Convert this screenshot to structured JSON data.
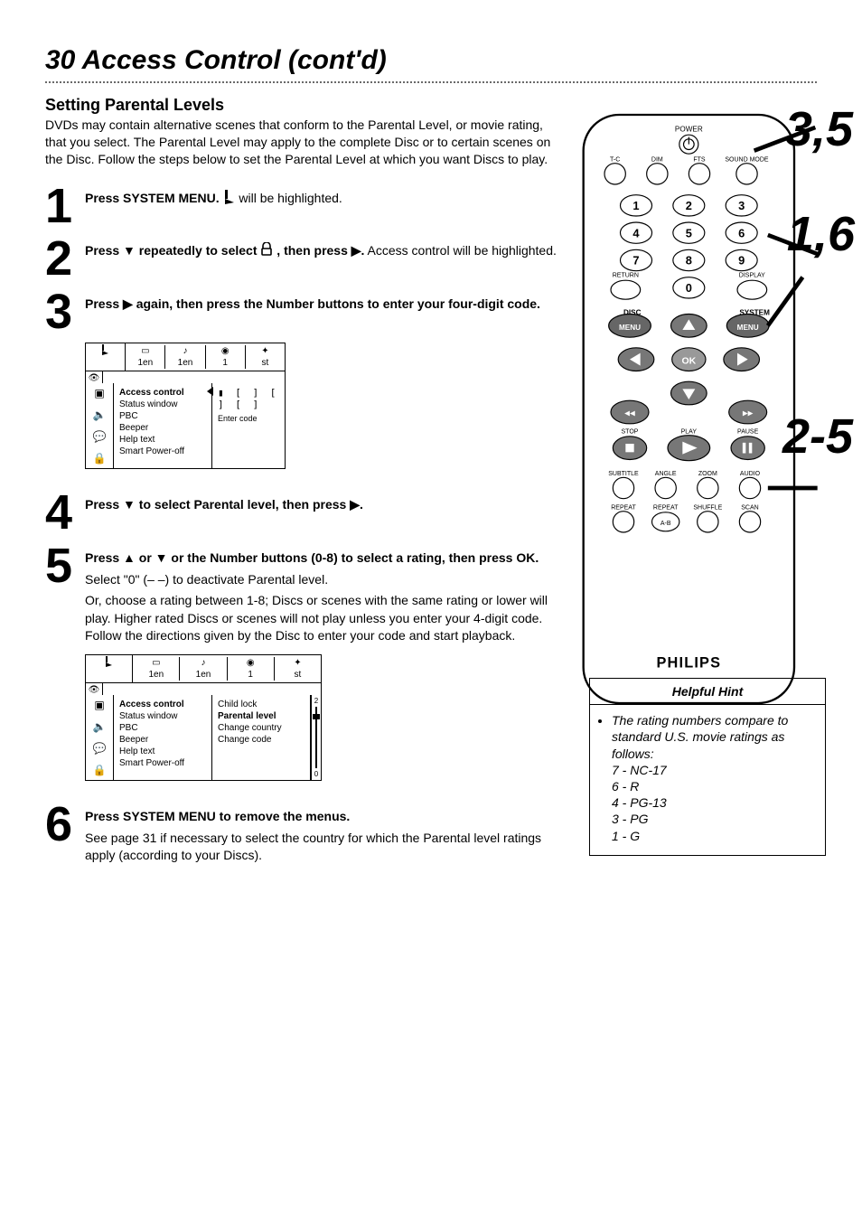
{
  "page_title": "30  Access Control (cont'd)",
  "section_heading": "Setting Parental Levels",
  "intro": "DVDs may contain alternative scenes that conform to the Parental Level, or movie rating, that you select. The Parental Level may apply to the complete Disc or to certain scenes on the Disc. Follow the steps below to set the Parental Level at which you want Discs to play.",
  "steps": {
    "s1_num": "1",
    "s1_strong": "Press SYSTEM MENU.",
    "s1_rest": " will be highlighted.",
    "s2_num": "2",
    "s2_strong_a": "Press ▼ repeatedly to select ",
    "s2_strong_b": ", then press ▶.",
    "s2_rest": " Access control will be highlighted.",
    "s3_num": "3",
    "s3_strong": "Press ▶ again, then press the Number buttons to enter your four-digit code.",
    "s4_num": "4",
    "s4_strong": "Press ▼ to select Parental level, then press ▶.",
    "s5_num": "5",
    "s5_strong": "Press ▲ or ▼ or the Number buttons (0-8) to select a rating, then press OK.",
    "s5_p1": "Select \"0\" (– –) to deactivate Parental level.",
    "s5_p2": "Or, choose a rating between 1-8; Discs or scenes with the same rating or lower will play. Higher rated Discs or scenes will not play unless you enter your 4-digit code. Follow the directions given by the Disc to enter your code and start playback.",
    "s6_num": "6",
    "s6_strong": "Press SYSTEM MENU to remove the menus.",
    "s6_rest": "See page 31 if necessary to select the country for which the Parental level ratings apply (according to your Discs)."
  },
  "osd1": {
    "top_labels": [
      "1en",
      "1en",
      "1",
      "st"
    ],
    "menu": [
      "Access control",
      "Status window",
      "PBC",
      "Beeper",
      "Help text",
      "Smart Power-off"
    ],
    "right_slots": "▮ [ ] [ ] [ ]",
    "right_text": "Enter code"
  },
  "osd2": {
    "top_labels": [
      "1en",
      "1en",
      "1",
      "st"
    ],
    "menu": [
      "Access control",
      "Status window",
      "PBC",
      "Beeper",
      "Help text",
      "Smart Power-off"
    ],
    "submenu": [
      "Child lock",
      "Parental level",
      "Change country",
      "Change code"
    ],
    "slider_top": "2",
    "slider_bottom": "0"
  },
  "remote": {
    "top_labels": [
      "POWER",
      "T-C",
      "DIM",
      "FTS",
      "SOUND MODE"
    ],
    "numpad": [
      "1",
      "2",
      "3",
      "4",
      "5",
      "6",
      "7",
      "8",
      "9",
      "0"
    ],
    "return": "RETURN",
    "display": "DISPLAY",
    "disc_menu": "DISC MENU",
    "system_menu": "SYSTEM MENU",
    "ok": "OK",
    "transport": [
      "STOP",
      "PLAY",
      "PAUSE"
    ],
    "row_btns": [
      "SUBTITLE",
      "ANGLE",
      "ZOOM",
      "AUDIO"
    ],
    "row_btns2": [
      "REPEAT",
      "REPEAT A-B",
      "SHUFFLE",
      "SCAN"
    ],
    "brand": "PHILIPS"
  },
  "callouts": {
    "c1": "3,5",
    "c2": "1,6",
    "c3": "2-5"
  },
  "hint": {
    "title": "Helpful Hint",
    "lead": "The rating numbers compare to standard U.S. movie ratings as follows:",
    "ratings": [
      "7 - NC-17",
      "6 - R",
      "4 - PG-13",
      "3 - PG",
      "1 - G"
    ]
  }
}
